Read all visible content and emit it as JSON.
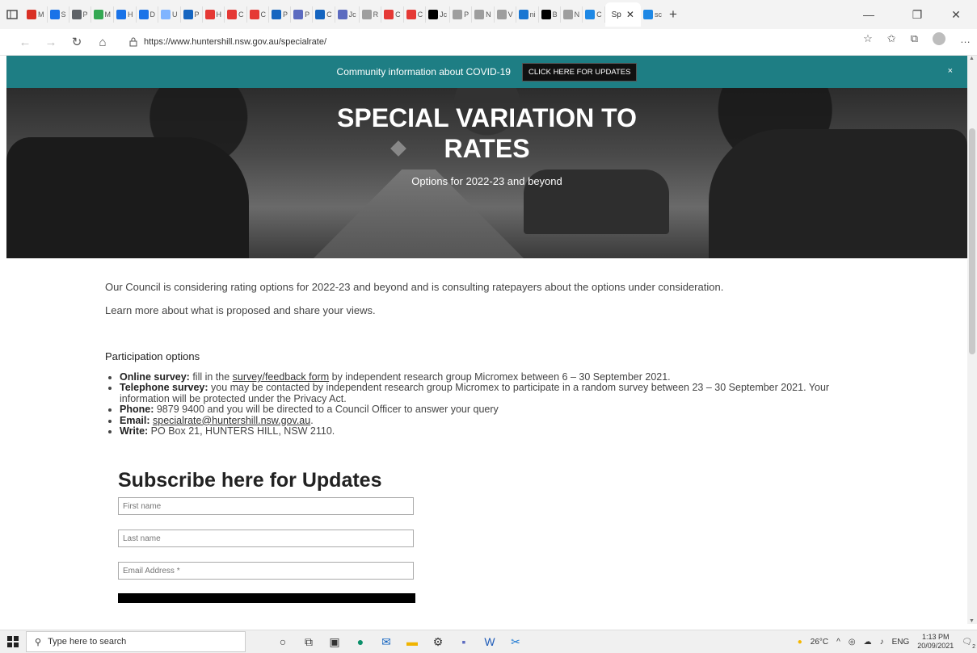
{
  "browser": {
    "active_tab_label": "Sp",
    "second_tab_label": "sc",
    "new_tab_symbol": "+",
    "address": "https://www.huntershill.nsw.gov.au/specialrate/",
    "mini_tabs": [
      "M",
      "S",
      "P",
      "M",
      "H",
      "D",
      "U",
      "P",
      "H",
      "C",
      "C",
      "P",
      "P",
      "C",
      "Jc",
      "R",
      "C",
      "C",
      "Jc",
      "P",
      "N",
      "V",
      "ni",
      "B",
      "N",
      "C"
    ],
    "mini_tab_colors": [
      "#d93025",
      "#1a73e8",
      "#5f6368",
      "#34a853",
      "#1a73e8",
      "#1a73e8",
      "#80b4ff",
      "#1565c0",
      "#e53935",
      "#e53935",
      "#e53935",
      "#1565c0",
      "#5c6bc0",
      "#1565c0",
      "#5c6bc0",
      "#9e9e9e",
      "#e53935",
      "#e53935",
      "#000000",
      "#9e9e9e",
      "#9e9e9e",
      "#9e9e9e",
      "#1976d2",
      "#000000",
      "#9e9e9e",
      "#1e88e5"
    ]
  },
  "banner": {
    "text": "Community information about COVID-19",
    "button_label": "CLICK HERE FOR UPDATES",
    "close_symbol": "×"
  },
  "hero": {
    "title_line1": "SPECIAL VARIATION TO",
    "title_line2": "RATES",
    "subtitle": "Options for 2022-23 and beyond"
  },
  "content": {
    "intro1": "Our Council is considering rating options for 2022-23 and beyond and is consulting ratepayers about the options under consideration.",
    "intro2": "Learn more about what is proposed and share your views.",
    "participation_heading": "Participation options",
    "options": {
      "online_label": "Online survey:",
      "online_pre": " fill in the ",
      "online_link": "survey/feedback form",
      "online_post": " by independent research group Micromex between 6 – 30 September 2021.",
      "telephone_label": "Telephone survey:",
      "telephone_text": " you may be contacted by independent research group Micromex to participate in a random survey between 23 – 30 September 2021. Your information will be protected under the Privacy Act.",
      "phone_label": "Phone:",
      "phone_text": " 9879 9400 and you will be directed to a Council Officer to answer your query",
      "email_label": "Email:",
      "email_link": "specialrate@huntershill.nsw.gov.au",
      "email_post": ".",
      "write_label": "Write:",
      "write_text": " PO Box 21, HUNTERS HILL, NSW 2110."
    }
  },
  "subscribe": {
    "title": "Subscribe here for Updates",
    "first_name_placeholder": "First name",
    "last_name_placeholder": "Last name",
    "email_placeholder": "Email Address *"
  },
  "taskbar": {
    "search_placeholder": "Type here to search",
    "temperature": "26°C",
    "language": "ENG",
    "time": "1:13 PM",
    "date": "20/09/2021",
    "notification_count": "2"
  }
}
